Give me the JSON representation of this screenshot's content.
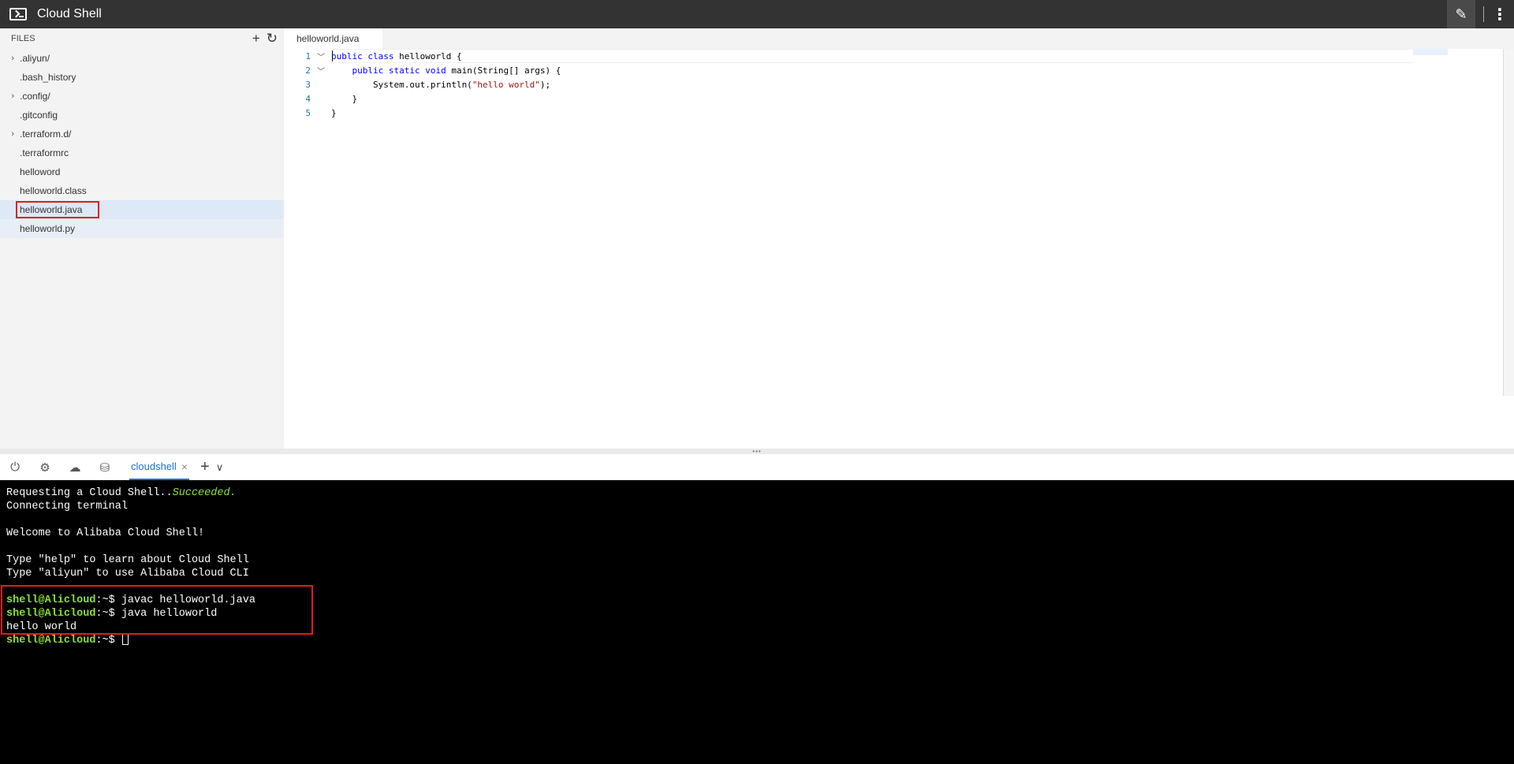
{
  "app": {
    "title": "Cloud Shell"
  },
  "sidebar": {
    "title": "FILES",
    "new_icon": "plus-icon",
    "refresh_icon": "refresh-icon",
    "files": [
      {
        "name": ".aliyun/",
        "folder": true
      },
      {
        "name": ".bash_history",
        "folder": false
      },
      {
        "name": ".config/",
        "folder": true
      },
      {
        "name": ".gitconfig",
        "folder": false
      },
      {
        "name": ".terraform.d/",
        "folder": true
      },
      {
        "name": ".terraformrc",
        "folder": false
      },
      {
        "name": "helloword",
        "folder": false
      },
      {
        "name": "helloworld.class",
        "folder": false
      },
      {
        "name": "helloworld.java",
        "folder": false,
        "selected": true
      },
      {
        "name": "helloworld.py",
        "folder": false
      }
    ]
  },
  "editor": {
    "tab": "helloworld.java",
    "lines": [
      {
        "n": "1",
        "fold": true
      },
      {
        "n": "2",
        "fold": true
      },
      {
        "n": "3",
        "fold": false
      },
      {
        "n": "4",
        "fold": false
      },
      {
        "n": "5",
        "fold": false
      }
    ],
    "code": {
      "l1a": "public class",
      "l1b": " helloworld {",
      "l2a": "    public static void",
      "l2b": " main(String[] args) {",
      "l3a": "        System.out.println(",
      "l3b": "\"hello world\"",
      "l3c": ");",
      "l4": "    }",
      "l5": "}"
    }
  },
  "terminal_toolbar": {
    "icons": [
      "power-icon",
      "gear-icon",
      "cloud-upload-icon",
      "storage-icon"
    ],
    "tab_label": "cloudshell",
    "add_label": "+",
    "dropdown_label": "∨"
  },
  "terminal": {
    "line1_a": "Requesting a Cloud Shell..",
    "line1_b": "Succeeded.",
    "line2": "Connecting terminal",
    "line3": "Welcome to Alibaba Cloud Shell!",
    "line4": "Type \"help\" to learn about Cloud Shell",
    "line5": "Type \"aliyun\" to use Alibaba Cloud CLI",
    "prompt": "shell@Alicloud",
    "path": ":~$ ",
    "cmd1": "javac helloworld.java",
    "cmd2": "java helloworld",
    "output": "hello world"
  },
  "colors": {
    "accent": "#1f6fd8",
    "highlight": "#e21b1b",
    "prompt": "#8ae234",
    "titlebar": "#333333"
  }
}
